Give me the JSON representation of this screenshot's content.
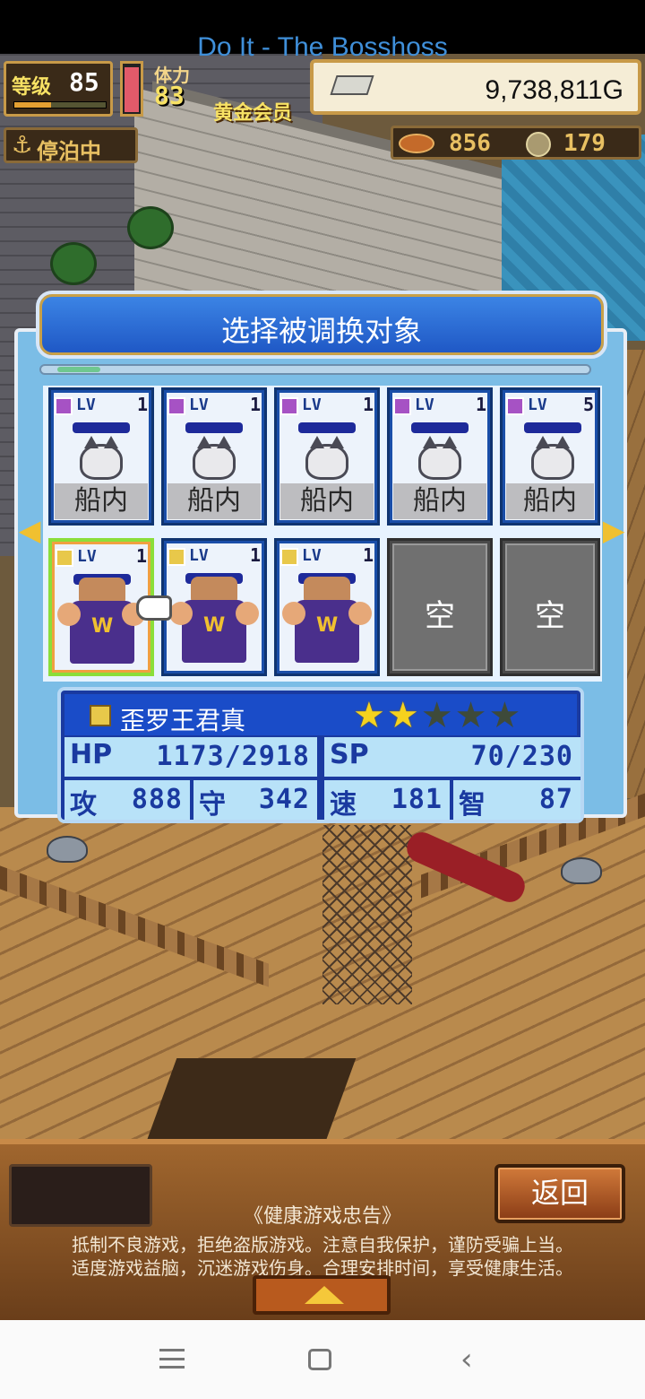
{
  "status": {
    "song_title": "Do It - The Bosshoss"
  },
  "hud": {
    "level_label": "等级",
    "level": "85",
    "stamina_label": "体力",
    "stamina": "83",
    "member": "黄金会员",
    "gold": "9,738,811G",
    "docked_label": "停泊中",
    "resource1": "856",
    "resource2": "179"
  },
  "dialog": {
    "title": "选择被调换对象",
    "top_row": [
      {
        "lv_tag": "LV",
        "lv": "1",
        "location": "船内"
      },
      {
        "lv_tag": "LV",
        "lv": "1",
        "location": "船内"
      },
      {
        "lv_tag": "LV",
        "lv": "1",
        "location": "船内"
      },
      {
        "lv_tag": "LV",
        "lv": "1",
        "location": "船内"
      },
      {
        "lv_tag": "LV",
        "lv": "5",
        "location": "船内"
      }
    ],
    "bottom_row": [
      {
        "lv_tag": "LV",
        "lv": "1"
      },
      {
        "lv_tag": "LV",
        "lv": "1"
      },
      {
        "lv_tag": "LV",
        "lv": "1"
      },
      {
        "empty": "空"
      },
      {
        "empty": "空"
      }
    ]
  },
  "selected": {
    "name": "歪罗王君真",
    "stars": 2,
    "stars_max": 5,
    "hp_label": "HP",
    "hp": "1173/2918",
    "sp_label": "SP",
    "sp": "70/230",
    "atk_label": "攻",
    "atk": "888",
    "def_label": "守",
    "def": "342",
    "spd_label": "速",
    "spd": "181",
    "int_label": "智",
    "int": "87"
  },
  "footer": {
    "back": "返回",
    "notice_title": "《健康游戏忠告》",
    "notice_line1": "抵制不良游戏，拒绝盗版游戏。注意自我保护，谨防受骗上当。",
    "notice_line2": "适度游戏益脑，沉迷游戏伤身。合理安排时间，享受健康生活。"
  },
  "colors": {
    "accent": "#1e56c4",
    "star": "#f5d21e"
  }
}
